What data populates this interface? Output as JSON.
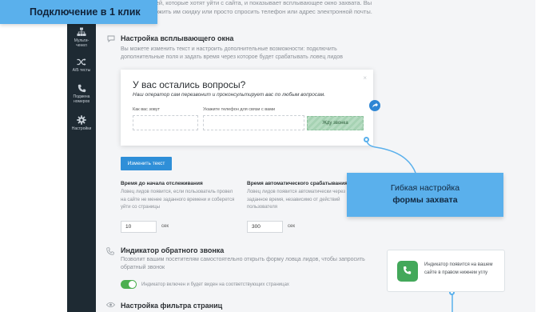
{
  "banner": {
    "label": "Подключение в 1 клик"
  },
  "top_description": "...пользователей, которые хотят уйти с сайта, и показывает всплывающее окно захвата. Вы можете предложить им скидку или просто спросить телефон или адрес электронной почты.",
  "sidebar": {
    "items": [
      {
        "label": "Мульти-\nченел",
        "icon": "hierarchy-icon"
      },
      {
        "label": "A/Б тесты",
        "icon": "shuffle-icon"
      },
      {
        "label": "Подмена\nномеров",
        "icon": "phone-icon"
      },
      {
        "label": "Настройки",
        "icon": "gear-icon"
      }
    ]
  },
  "popup_settings": {
    "title": "Настройка всплывающего окна",
    "description": "Вы можете изменить текст и настроить дополнительные возможности: подключить дополнительные поля и задать время через которое будет срабатывать ловец лидов"
  },
  "popup_preview": {
    "title": "У вас остались вопросы?",
    "subtitle": "Наш оператор сам перезвонит и проконсультирует вас по любым вопросам.",
    "name_label": "Как вас зовут",
    "phone_label": "Укажите телефон для связи с вами",
    "call_button": "Жду звонка",
    "close": "×"
  },
  "edit_button": "Изменить текст",
  "tracking_delay": {
    "title": "Время до начала отслеживания",
    "description": "Ловец лидов появится, если пользователь провел на сайте не менее заданного времени и соберется уйти со страницы",
    "value": "10",
    "unit": "сек"
  },
  "auto_trigger": {
    "title": "Время автоматического срабатывания",
    "description": "Ловец лидов появится автоматически через заданное время, независимо от действий пользователя",
    "value": "300",
    "unit": "сек"
  },
  "callout": {
    "line1": "Гибкая настройка",
    "line2": "формы захвата"
  },
  "callback_indicator": {
    "title": "Индикатор обратного звонка",
    "description": "Позволит вашим посетителям самостоятельно открыть форму ловца лидов, чтобы запросить обратный звонок",
    "toggle_label": "Индикатор включен и будет виден на соответствующих страницах",
    "toggle_on": true
  },
  "page_filter": {
    "title": "Настройка фильтра страниц"
  },
  "notice": {
    "text": "Индикатор появится на вашем сайте в правом нижнем углу"
  },
  "colors": {
    "accent": "#5ab0ec",
    "sidebar": "#1e2a33",
    "button": "#2f8fd8",
    "toggle": "#4caf50"
  }
}
